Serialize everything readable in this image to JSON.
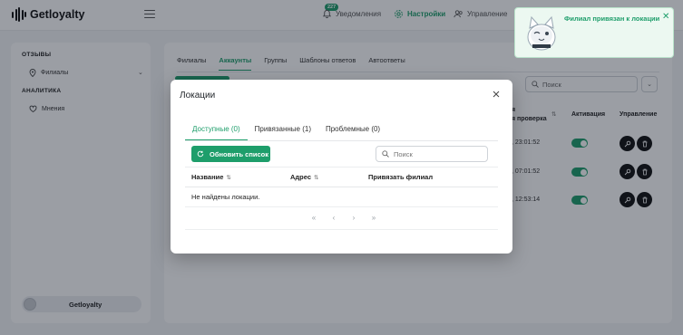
{
  "app": {
    "logo_text": "Getloyalty"
  },
  "topnav": {
    "notifications_label": "Уведомления",
    "notifications_badge": "227",
    "settings_label": "Настройки",
    "manage_label": "Управление"
  },
  "sidebar": {
    "section_reviews": "ОТЗЫВЫ",
    "item_branches": "Филиалы",
    "section_analytics": "АНАЛИТИКА",
    "item_opinions": "Мнения",
    "user_name": "Getloyalty"
  },
  "main": {
    "tabs": [
      {
        "label": "Филиалы"
      },
      {
        "label": "Аккаунты"
      },
      {
        "label": "Группы"
      },
      {
        "label": "Шаблоны ответов"
      },
      {
        "label": "Автоответы"
      }
    ],
    "search_placeholder": "Поиск",
    "col_check_line1": "я",
    "col_check_line2": "я проверка",
    "col_activation": "Активация",
    "col_manage": "Управление",
    "rows": [
      {
        "time": ", 23:01:52"
      },
      {
        "time": ", 07:01:52"
      },
      {
        "time": ", 12:53:14"
      }
    ]
  },
  "modal": {
    "title": "Локации",
    "tabs": [
      {
        "label": "Доступные (0)"
      },
      {
        "label": "Привязанные (1)"
      },
      {
        "label": "Проблемные (0)"
      }
    ],
    "refresh_label": "Обновить список",
    "search_placeholder": "Поиск",
    "columns": [
      {
        "label": "Название"
      },
      {
        "label": "Адрес"
      },
      {
        "label": "Привязать филиал"
      }
    ],
    "empty_text": "Не найдены локации.",
    "pager": {
      "first": "«",
      "prev": "‹",
      "next": "›",
      "last": "»"
    }
  },
  "toast": {
    "message": "Филиал привязан к локации",
    "close": "✕"
  },
  "colors": {
    "accent": "#1e9e6b",
    "overlay": "rgba(17,24,39,0.42)"
  },
  "icons": [
    "bell-icon",
    "gear-icon",
    "users-icon",
    "pin-icon",
    "heart-icon",
    "search-icon",
    "refresh-icon",
    "close-icon",
    "key-icon",
    "trash-icon",
    "chevron-down-icon"
  ]
}
